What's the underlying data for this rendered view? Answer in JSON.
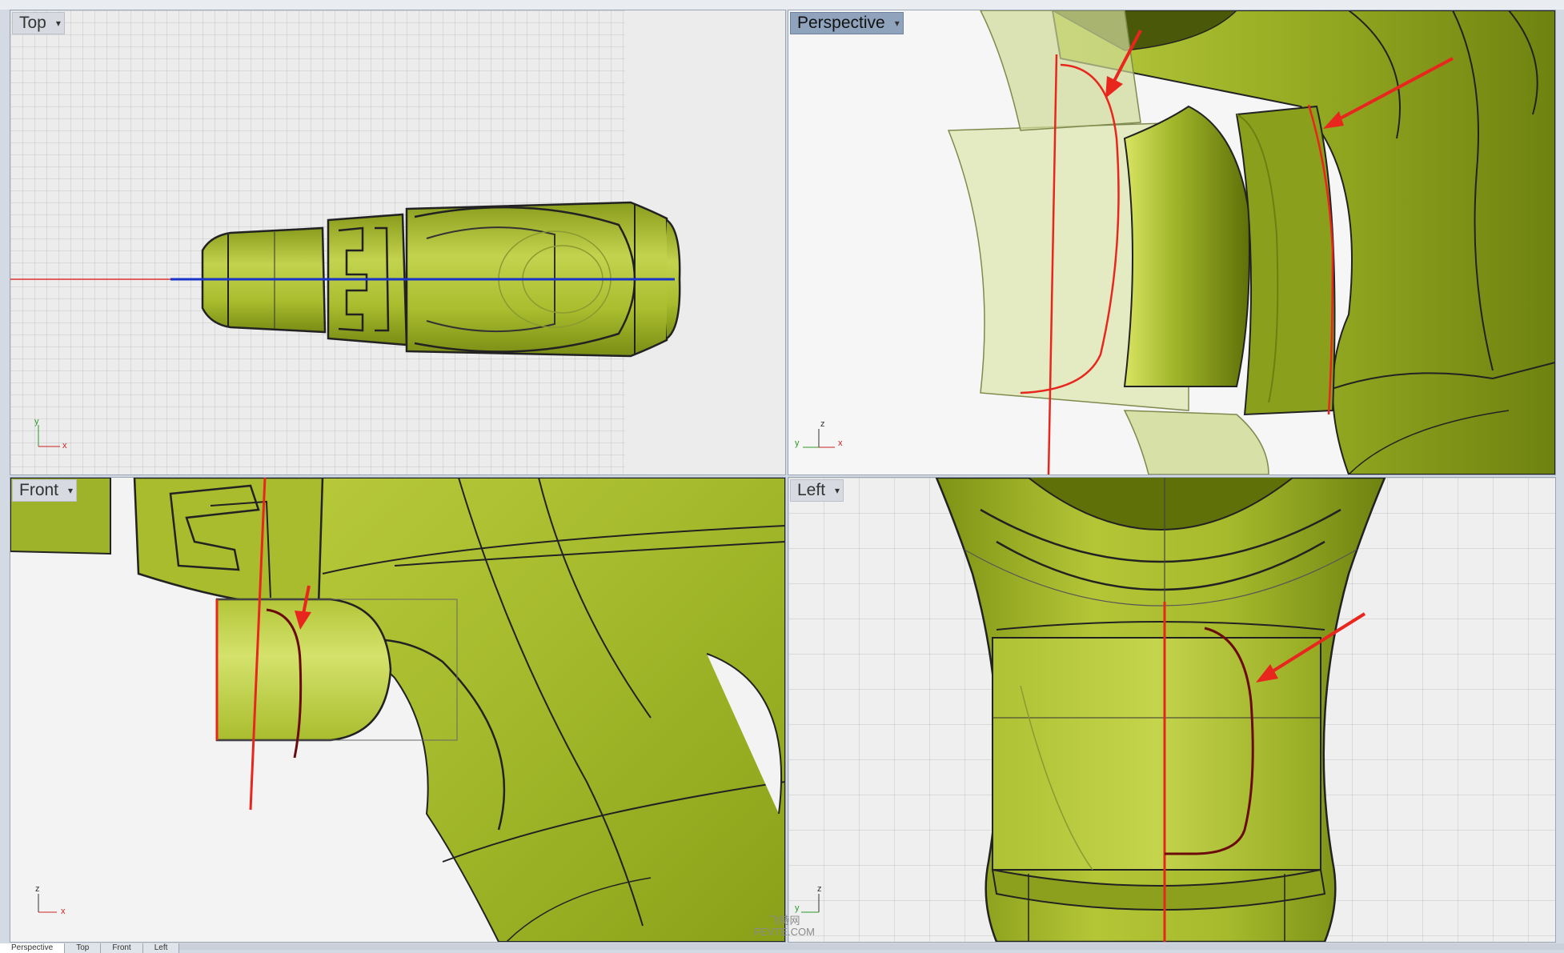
{
  "viewports": {
    "top": {
      "label": "Top",
      "axis_v": "y",
      "axis_h": "x"
    },
    "perspective": {
      "label": "Perspective",
      "axis_v": "z",
      "axis_h": "x",
      "axis_d": "y"
    },
    "front": {
      "label": "Front",
      "axis_v": "z",
      "axis_h": "x"
    },
    "left": {
      "label": "Left",
      "axis_v": "z",
      "axis_h": "y"
    }
  },
  "dropdown_glyph": "▾",
  "bottom_tabs": [
    "Perspective",
    "Top",
    "Front",
    "Left"
  ],
  "active_tab": "Perspective",
  "watermark": {
    "line1": "飞特网",
    "line2": "FEVTE.COM"
  },
  "colors": {
    "model_green": "#a7bd2c",
    "model_dark": "#6d7f10",
    "model_light": "#d3e06a",
    "curve_red": "#e8261e",
    "grid": "#c4c4c4",
    "active_label_bg": "#8fa3bd"
  }
}
